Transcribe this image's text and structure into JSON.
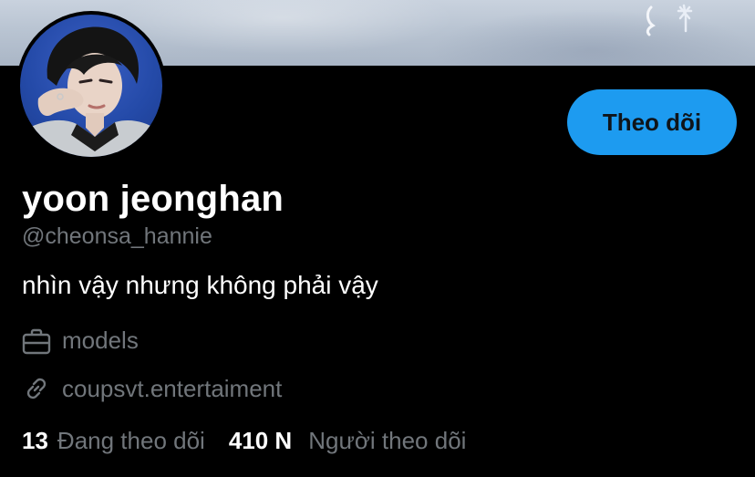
{
  "profile": {
    "display_name": "yoon jeonghan",
    "handle": "@cheonsa_hannie",
    "bio": "nhìn vậy nhưng không phải vậy",
    "occupation": "models",
    "website": "coupsvt.entertaiment"
  },
  "actions": {
    "follow_label": "Theo dõi"
  },
  "stats": {
    "following_count": "13",
    "following_label": "Đang theo dõi",
    "followers_count": "410 N",
    "followers_label": "Người theo dõi"
  },
  "icons": {
    "occupation": "briefcase-icon",
    "website": "link-icon"
  },
  "colors": {
    "accent": "#1d9bf0",
    "background": "#000000",
    "secondary_text": "#71767b",
    "primary_text": "#ffffff"
  }
}
